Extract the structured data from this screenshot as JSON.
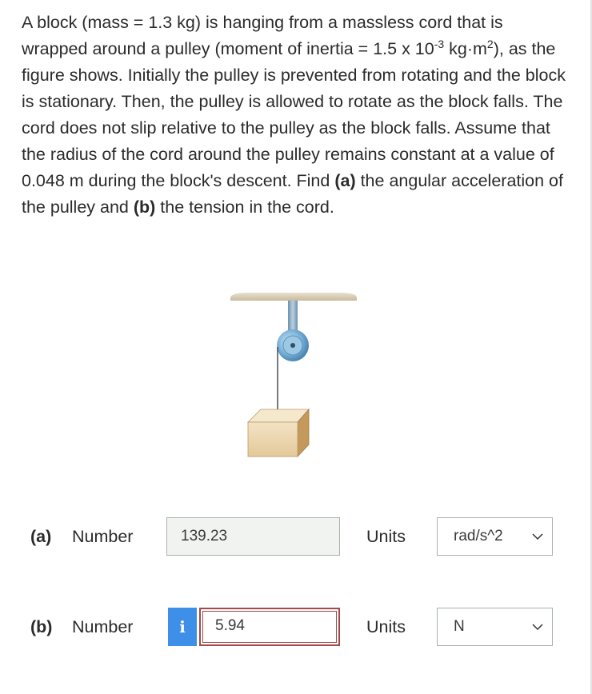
{
  "question": {
    "p1": "A block (mass = 1.3 kg) is hanging from a massless cord that is wrapped around a pulley (moment of inertia = 1.5 x 10",
    "exp1": "-3",
    "p2": " kg·m",
    "exp2": "2",
    "p3": "), as the figure shows. Initially the pulley is prevented from rotating and the block is stationary. Then, the pulley is allowed to rotate as the block falls. The cord does not slip relative to the pulley as the block falls. Assume that the radius of the cord around the pulley remains constant at a value of 0.048 m during the block's descent. Find ",
    "part_a": "(a)",
    "p4": " the angular acceleration of the pulley and ",
    "part_b": "(b)",
    "p5": " the tension in the cord."
  },
  "figure": {
    "ceiling_icon": "ceiling-icon",
    "pulley_icon": "pulley-icon",
    "block_icon": "block-icon",
    "colors": {
      "ceiling": "#d8cdb8",
      "bracket": "#8aa9c3",
      "pulley": "#6fa8cf",
      "block": "#d9b98a"
    }
  },
  "answers": [
    {
      "part": "(a)",
      "number_label": "Number",
      "value": "139.23",
      "units_label": "Units",
      "unit": "rad/s^2",
      "status": "normal"
    },
    {
      "part": "(b)",
      "number_label": "Number",
      "value": "5.94",
      "info_icon": "i",
      "units_label": "Units",
      "unit": "N",
      "status": "error"
    }
  ],
  "colors": {
    "info_button": "#3d8fe8",
    "error_border": "#a34a4a",
    "input_bg": "#f1f3f1"
  }
}
